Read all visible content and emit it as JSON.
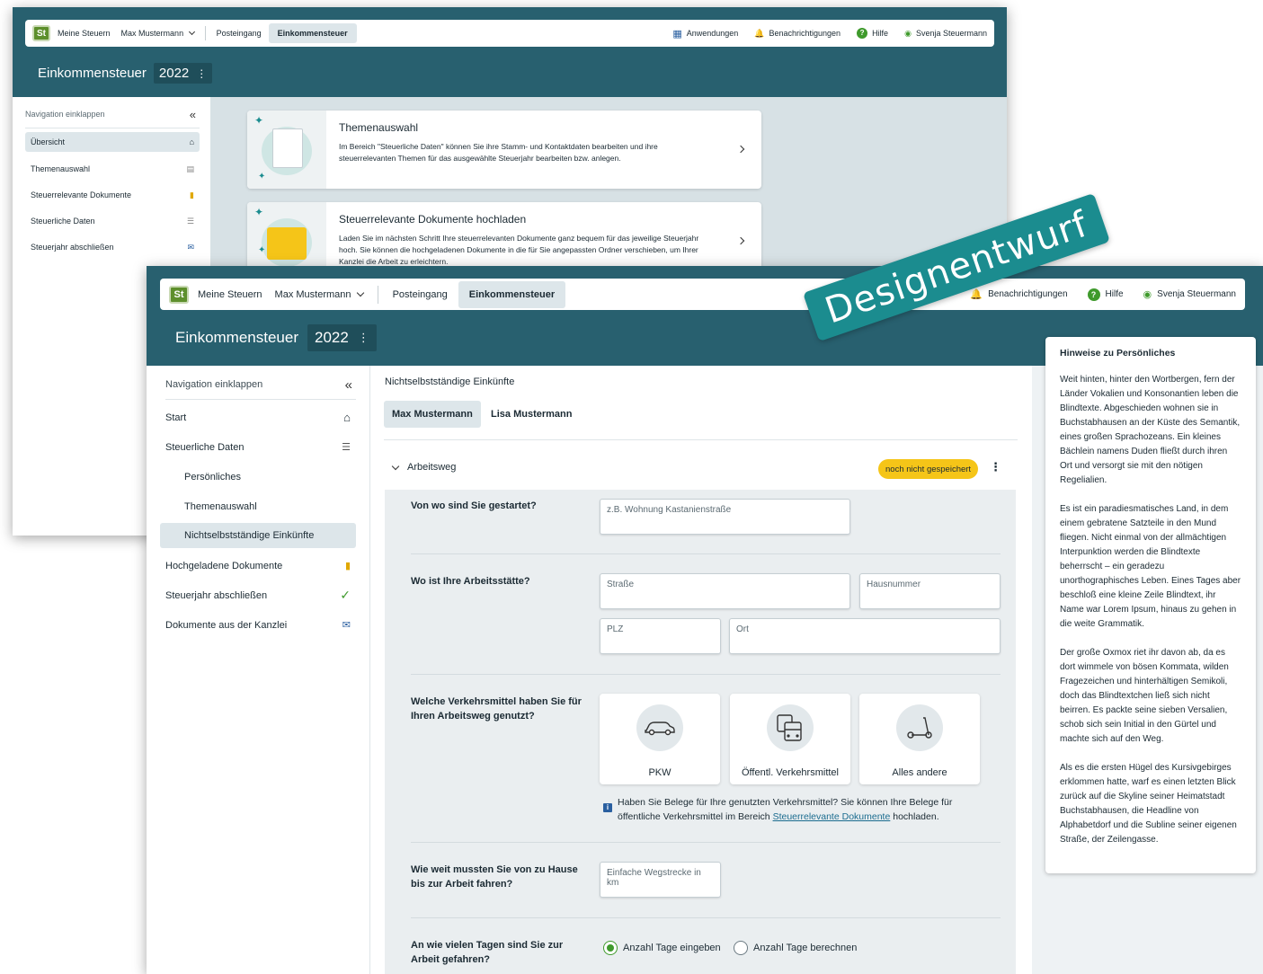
{
  "back": {
    "nav": {
      "logo": "St",
      "meine_steuern": "Meine Steuern",
      "user_menu": "Max Mustermann",
      "posteingang": "Posteingang",
      "einkommensteuer": "Einkommensteuer",
      "anwendungen": "Anwendungen",
      "benachrichtigungen": "Benachrichtigungen",
      "hilfe": "Hilfe",
      "user": "Svenja Steuermann"
    },
    "title": "Einkommensteuer",
    "year": "2022",
    "year_menu": "⋮",
    "sidebar": {
      "collapse": "Navigation einklappen",
      "collapse_icon": "«",
      "items": [
        {
          "label": "Übersicht",
          "icon": "⌂"
        },
        {
          "label": "Themenauswahl",
          "icon": "▤"
        },
        {
          "label": "Steuerrelevante Dokumente",
          "icon": "▮"
        },
        {
          "label": "Steuerliche Daten",
          "icon": "☰"
        },
        {
          "label": "Steuerjahr abschließen",
          "icon": "✉"
        }
      ]
    },
    "cards": [
      {
        "title": "Themenauswahl",
        "text": "Im Bereich \"Steuerliche Daten\" können Sie ihre Stamm- und Kontaktdaten bearbeiten und ihre steuerrelevanten Themen für das ausgewählte Steuerjahr bearbeiten bzw. anlegen."
      },
      {
        "title": "Steuerrelevante Dokumente hochladen",
        "text": "Laden Sie im nächsten Schritt Ihre steuerrelevanten Dokumente ganz bequem für das jeweilige Steuerjahr hoch. Sie können die hochgeladenen Dokumente in die für Sie angepassten Ordner verschieben, um Ihrer Kanzlei die Arbeit zu erleichtern."
      }
    ]
  },
  "front": {
    "nav": {
      "logo": "St",
      "meine_steuern": "Meine Steuern",
      "user_menu": "Max Mustermann",
      "posteingang": "Posteingang",
      "einkommensteuer": "Einkommensteuer",
      "benachrichtigungen": "Benachrichtigungen",
      "hilfe": "Hilfe",
      "user": "Svenja Steuermann"
    },
    "title": "Einkommensteuer",
    "year": "2022",
    "year_menu": "⋮",
    "sidebar": {
      "collapse": "Navigation einklappen",
      "collapse_icon": "«",
      "start": "Start",
      "steuerliche_daten": "Steuerliche Daten",
      "persoenliches": "Persönliches",
      "themenauswahl": "Themenauswahl",
      "nichtselbst": "Nichtselbstständige Einkünfte",
      "hochgeladen": "Hochgeladene Dokumente",
      "abschliessen": "Steuerjahr abschließen",
      "kanzlei": "Dokumente aus der Kanzlei"
    },
    "section_title": "Nichtselbstständige Einkünfte",
    "person_tabs": [
      "Max Mustermann",
      "Lisa Mustermann"
    ],
    "accordion": "Arbeitsweg",
    "status_badge": "noch nicht gespeichert",
    "more": "⋮",
    "form": {
      "q1": "Von wo sind Sie gestartet?",
      "q1_ph": "z.B. Wohnung Kastanienstraße",
      "q2": "Wo ist Ihre Arbeitsstätte?",
      "strasse": "Straße",
      "hausnummer": "Hausnummer",
      "plz": "PLZ",
      "ort": "Ort",
      "q3": "Welche Verkehrsmittel haben Sie für Ihren Arbeitsweg genutzt?",
      "tiles": [
        "PKW",
        "Öffentl. Verkehrsmittel",
        "Alles andere"
      ],
      "info_pre": "Haben Sie Belege für Ihre genutzten Verkehrsmittel? Sie können Ihre Belege für öffentliche Verkehrsmittel im Bereich ",
      "info_link": "Steuerrelevante Dokumente",
      "info_post": " hochladen.",
      "q4": "Wie weit mussten Sie von zu Hause bis zur Arbeit fahren?",
      "q4_ph": "Einfache Wegstrecke in km",
      "q5": "An wie vielen Tagen sind Sie zur Arbeit gefahren?",
      "r1": "Anzahl Tage eingeben",
      "r2": "Anzahl Tage berechnen"
    }
  },
  "hint": {
    "title": "Hinweise zu Persönliches",
    "paragraphs": [
      "Weit hinten, hinter den Wortbergen, fern der Länder Vokalien und Konsonantien leben die Blindtexte. Abgeschieden wohnen sie in Buchstabhausen an der Küste des Semantik, eines großen Sprachozeans. Ein kleines Bächlein namens Duden fließt durch ihren Ort und versorgt sie mit den nötigen Regelialien.",
      "Es ist ein paradiesmatisches Land, in dem einem gebratene Satzteile in den Mund fliegen. Nicht einmal von der allmächtigen Interpunktion werden die Blindtexte beherrscht – ein geradezu unorthographisches Leben. Eines Tages aber beschloß eine kleine Zeile Blindtext, ihr Name war Lorem Ipsum, hinaus zu gehen in die weite Grammatik.",
      "Der große Oxmox riet ihr davon ab, da es dort wimmele von bösen Kommata, wilden Fragezeichen und hinterhältigen Semikoli, doch das Blindtextchen ließ sich nicht beirren. Es packte seine sieben Versalien, schob sich sein Initial in den Gürtel und machte sich auf den Weg.",
      "Als es die ersten Hügel des Kursivgebirges erklommen hatte, warf es einen letzten Blick zurück auf die Skyline seiner Heimatstadt Buchstabhausen, die Headline von Alphabetdorf und die Subline seiner eigenen Straße, der Zeilengasse."
    ]
  },
  "banner": "Designentwurf",
  "colors": {
    "header": "#28606f",
    "accent": "#1b8c8f",
    "badge": "#f5c518",
    "green": "#3f9a2c"
  }
}
